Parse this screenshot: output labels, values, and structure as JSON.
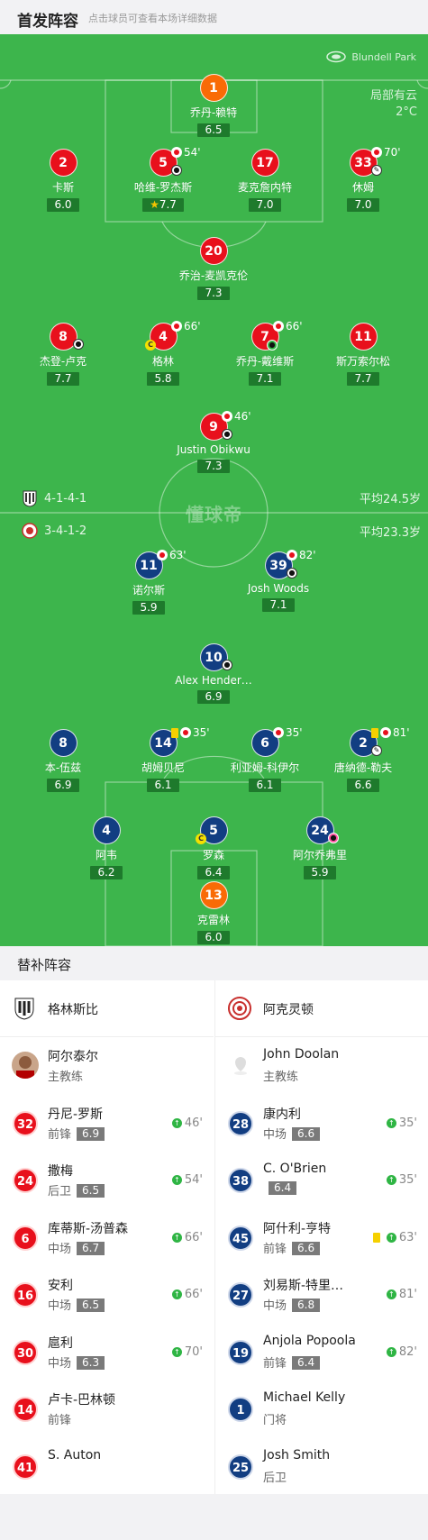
{
  "header": {
    "title": "首发阵容",
    "hint": "点击球员可查看本场详细数据"
  },
  "pitch": {
    "venue": "Blundell Park",
    "weather": "局部有云",
    "temp": "2°C",
    "watermark": "懂球帝"
  },
  "home": {
    "formation": "4-1-4-1",
    "avg_age": "平均24.5岁",
    "team": "格林斯比",
    "coach": "阿尔泰尔",
    "coach_role": "主教练",
    "color": "#e8101c"
  },
  "away": {
    "formation": "3-4-1-2",
    "avg_age": "平均23.3岁",
    "team": "阿克灵顿",
    "coach": "John Doolan",
    "coach_role": "主教练",
    "color": "#123e82"
  },
  "home_players": [
    {
      "num": "1",
      "name": "乔丹-赖特",
      "rating": "6.5"
    },
    {
      "num": "2",
      "name": "卡斯",
      "rating": "6.0"
    },
    {
      "num": "5",
      "name": "哈维-罗杰斯",
      "rating": "7.7",
      "sub": "54'"
    },
    {
      "num": "17",
      "name": "麦克詹内特",
      "rating": "7.0"
    },
    {
      "num": "33",
      "name": "休姆",
      "rating": "7.0",
      "sub": "70'"
    },
    {
      "num": "20",
      "name": "乔治-麦凯克伦",
      "rating": "7.3"
    },
    {
      "num": "8",
      "name": "杰登-卢克",
      "rating": "7.7"
    },
    {
      "num": "4",
      "name": "格林",
      "rating": "5.8",
      "sub": "66'"
    },
    {
      "num": "7",
      "name": "乔丹-戴维斯",
      "rating": "7.1",
      "sub": "66'"
    },
    {
      "num": "11",
      "name": "斯万索尔松",
      "rating": "7.7"
    },
    {
      "num": "9",
      "name": "Justin Obikwu",
      "rating": "7.3",
      "sub": "46'"
    }
  ],
  "away_players": [
    {
      "num": "11",
      "name": "诺尔斯",
      "rating": "5.9",
      "sub": "63'"
    },
    {
      "num": "39",
      "name": "Josh Woods",
      "rating": "7.1",
      "sub": "82'"
    },
    {
      "num": "10",
      "name": "Alex Hender…",
      "rating": "6.9"
    },
    {
      "num": "8",
      "name": "本-伍兹",
      "rating": "6.9"
    },
    {
      "num": "14",
      "name": "胡姆贝尼",
      "rating": "6.1",
      "sub": "35'"
    },
    {
      "num": "6",
      "name": "利亚姆-科伊尔",
      "rating": "6.1",
      "sub": "35'"
    },
    {
      "num": "2",
      "name": "唐纳德-勒夫",
      "rating": "6.6",
      "sub": "81'"
    },
    {
      "num": "4",
      "name": "阿韦",
      "rating": "6.2"
    },
    {
      "num": "5",
      "name": "罗森",
      "rating": "6.4"
    },
    {
      "num": "24",
      "name": "阿尔乔弗里",
      "rating": "5.9"
    },
    {
      "num": "13",
      "name": "克雷林",
      "rating": "6.0"
    }
  ],
  "subs_title": "替补阵容",
  "home_subs": [
    {
      "num": "32",
      "name": "丹尼-罗斯",
      "pos": "前锋",
      "rating": "6.9",
      "minute": "46'"
    },
    {
      "num": "24",
      "name": "撒梅",
      "pos": "后卫",
      "rating": "6.5",
      "minute": "54'"
    },
    {
      "num": "6",
      "name": "库蒂斯-汤普森",
      "pos": "中场",
      "rating": "6.7",
      "minute": "66'"
    },
    {
      "num": "16",
      "name": "安利",
      "pos": "中场",
      "rating": "6.5",
      "minute": "66'"
    },
    {
      "num": "30",
      "name": "扈利",
      "pos": "中场",
      "rating": "6.3",
      "minute": "70'"
    },
    {
      "num": "14",
      "name": "卢卡-巴林顿",
      "pos": "前锋"
    },
    {
      "num": "41",
      "name": "S. Auton",
      "pos": ""
    }
  ],
  "away_subs": [
    {
      "num": "28",
      "name": "康内利",
      "pos": "中场",
      "rating": "6.6",
      "minute": "35'"
    },
    {
      "num": "38",
      "name": "C. O'Brien",
      "pos": "",
      "rating": "6.4",
      "minute": "35'"
    },
    {
      "num": "45",
      "name": "阿什利-亨特",
      "pos": "前锋",
      "rating": "6.6",
      "minute": "63'",
      "yellow": true
    },
    {
      "num": "27",
      "name": "刘易斯-特里…",
      "pos": "中场",
      "rating": "6.8",
      "minute": "81'"
    },
    {
      "num": "19",
      "name": "Anjola Popoola",
      "pos": "前锋",
      "rating": "6.4",
      "minute": "82'"
    },
    {
      "num": "1",
      "name": "Michael Kelly",
      "pos": "门将"
    },
    {
      "num": "25",
      "name": "Josh Smith",
      "pos": "后卫"
    }
  ]
}
